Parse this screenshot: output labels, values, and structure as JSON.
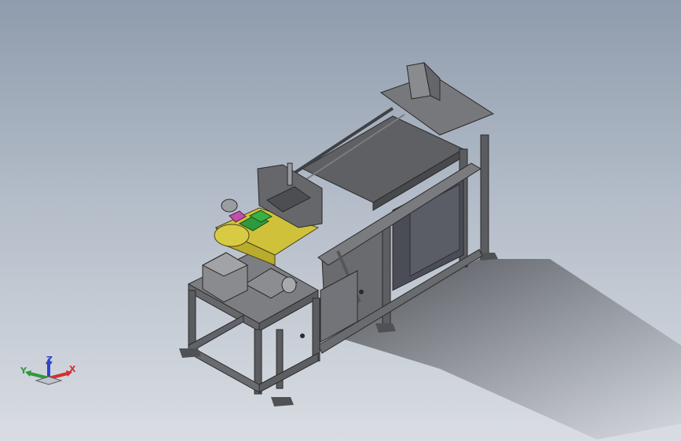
{
  "viewport": {
    "background_top": "#8f9cad",
    "background_bottom": "#d9dde3"
  },
  "model": {
    "frame_color": "#6b6b6b",
    "panel_color": "#55565a",
    "accent_yellow": "#cfc23a",
    "accent_green": "#2f9a3a",
    "accent_magenta": "#c24fa8",
    "cabinet_color": "#4a4c56"
  },
  "triad": {
    "x_label": "X",
    "y_label": "Y",
    "z_label": "Z",
    "x_color": "#d23030",
    "y_color": "#2f9a3a",
    "z_color": "#2f43c9"
  }
}
